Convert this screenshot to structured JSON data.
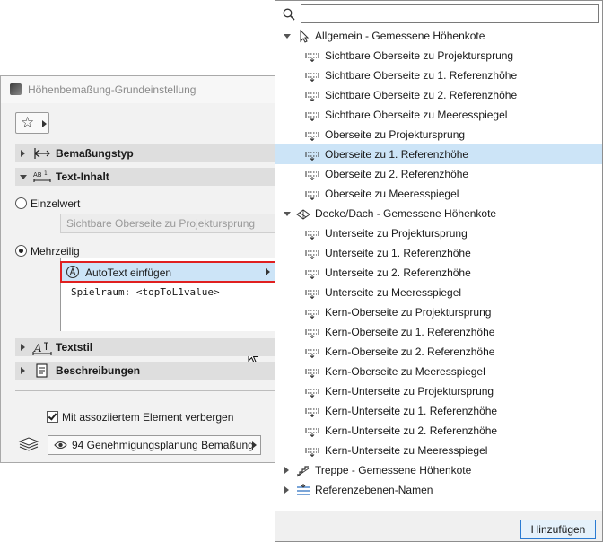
{
  "dialog": {
    "title": "Höhenbemaßung-Grundeinstellung",
    "sections": {
      "bemassungstyp": "Bemaßungstyp",
      "text_inhalt": "Text-Inhalt",
      "textstil": "Textstil",
      "beschreibungen": "Beschreibungen"
    },
    "radio_single": "Einzelwert",
    "single_value": "Sichtbare Oberseite zu Projektursprung",
    "radio_multi": "Mehrzeilig",
    "autotext_label": "AutoText einfügen",
    "content_line": "Spielraum: <topToL1value>",
    "hide_checkbox_label": "Mit assoziiertem Element verbergen",
    "layer_label": "94 Genehmigungsplanung Bemaßung"
  },
  "popup": {
    "search_value": "",
    "groups": [
      {
        "label": "Allgemein - Gemessene Höhenkote",
        "expanded": true,
        "icon": "cursor-arrow-icon",
        "items": [
          "Sichtbare Oberseite zu Projektursprung",
          "Sichtbare Oberseite zu 1. Referenzhöhe",
          "Sichtbare Oberseite zu 2. Referenzhöhe",
          "Sichtbare Oberseite zu Meeresspiegel",
          "Oberseite zu Projektursprung",
          "Oberseite zu 1. Referenzhöhe",
          "Oberseite zu 2. Referenzhöhe",
          "Oberseite zu Meeresspiegel"
        ]
      },
      {
        "label": "Decke/Dach - Gemessene Höhenkote",
        "expanded": true,
        "icon": "slab-roof-icon",
        "items": [
          "Unterseite zu Projektursprung",
          "Unterseite zu 1. Referenzhöhe",
          "Unterseite zu 2. Referenzhöhe",
          "Unterseite zu Meeresspiegel",
          "Kern-Oberseite zu Projektursprung",
          "Kern-Oberseite zu 1. Referenzhöhe",
          "Kern-Oberseite zu 2. Referenzhöhe",
          "Kern-Oberseite zu Meeresspiegel",
          "Kern-Unterseite zu Projektursprung",
          "Kern-Unterseite zu 1. Referenzhöhe",
          "Kern-Unterseite zu 2. Referenzhöhe",
          "Kern-Unterseite zu Meeresspiegel"
        ]
      },
      {
        "label": "Treppe - Gemessene Höhenkote",
        "expanded": false,
        "icon": "stair-icon",
        "items": []
      },
      {
        "label": "Referenzebenen-Namen",
        "expanded": false,
        "icon": "reference-levels-icon",
        "items": []
      }
    ],
    "selected_item": "Oberseite zu 1. Referenzhöhe",
    "add_button": "Hinzufügen"
  },
  "colors": {
    "selection": "#cce4f7",
    "highlight_border": "#e02020",
    "default_button_border": "#2a7bd3"
  }
}
